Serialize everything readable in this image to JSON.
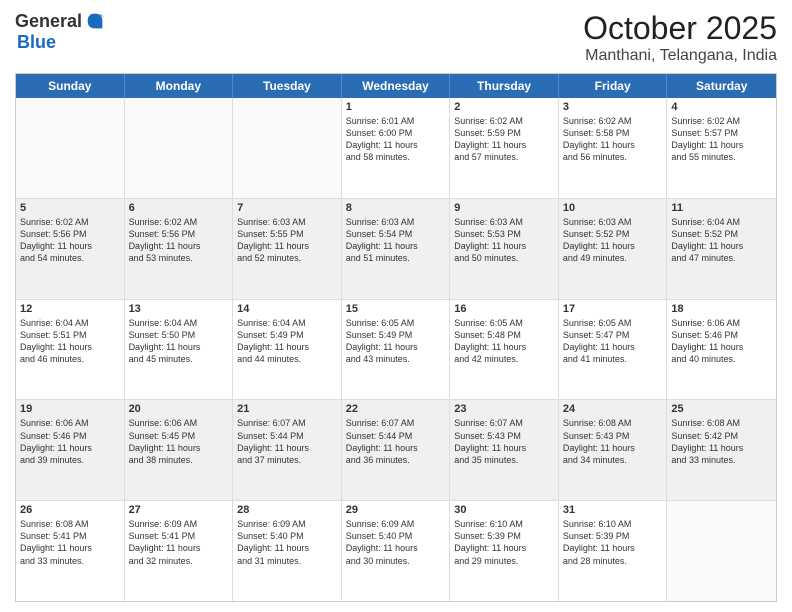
{
  "header": {
    "logo_general": "General",
    "logo_blue": "Blue",
    "title": "October 2025",
    "subtitle": "Manthani, Telangana, India"
  },
  "weekdays": [
    "Sunday",
    "Monday",
    "Tuesday",
    "Wednesday",
    "Thursday",
    "Friday",
    "Saturday"
  ],
  "weeks": [
    [
      {
        "day": "",
        "text": ""
      },
      {
        "day": "",
        "text": ""
      },
      {
        "day": "",
        "text": ""
      },
      {
        "day": "1",
        "text": "Sunrise: 6:01 AM\nSunset: 6:00 PM\nDaylight: 11 hours\nand 58 minutes."
      },
      {
        "day": "2",
        "text": "Sunrise: 6:02 AM\nSunset: 5:59 PM\nDaylight: 11 hours\nand 57 minutes."
      },
      {
        "day": "3",
        "text": "Sunrise: 6:02 AM\nSunset: 5:58 PM\nDaylight: 11 hours\nand 56 minutes."
      },
      {
        "day": "4",
        "text": "Sunrise: 6:02 AM\nSunset: 5:57 PM\nDaylight: 11 hours\nand 55 minutes."
      }
    ],
    [
      {
        "day": "5",
        "text": "Sunrise: 6:02 AM\nSunset: 5:56 PM\nDaylight: 11 hours\nand 54 minutes."
      },
      {
        "day": "6",
        "text": "Sunrise: 6:02 AM\nSunset: 5:56 PM\nDaylight: 11 hours\nand 53 minutes."
      },
      {
        "day": "7",
        "text": "Sunrise: 6:03 AM\nSunset: 5:55 PM\nDaylight: 11 hours\nand 52 minutes."
      },
      {
        "day": "8",
        "text": "Sunrise: 6:03 AM\nSunset: 5:54 PM\nDaylight: 11 hours\nand 51 minutes."
      },
      {
        "day": "9",
        "text": "Sunrise: 6:03 AM\nSunset: 5:53 PM\nDaylight: 11 hours\nand 50 minutes."
      },
      {
        "day": "10",
        "text": "Sunrise: 6:03 AM\nSunset: 5:52 PM\nDaylight: 11 hours\nand 49 minutes."
      },
      {
        "day": "11",
        "text": "Sunrise: 6:04 AM\nSunset: 5:52 PM\nDaylight: 11 hours\nand 47 minutes."
      }
    ],
    [
      {
        "day": "12",
        "text": "Sunrise: 6:04 AM\nSunset: 5:51 PM\nDaylight: 11 hours\nand 46 minutes."
      },
      {
        "day": "13",
        "text": "Sunrise: 6:04 AM\nSunset: 5:50 PM\nDaylight: 11 hours\nand 45 minutes."
      },
      {
        "day": "14",
        "text": "Sunrise: 6:04 AM\nSunset: 5:49 PM\nDaylight: 11 hours\nand 44 minutes."
      },
      {
        "day": "15",
        "text": "Sunrise: 6:05 AM\nSunset: 5:49 PM\nDaylight: 11 hours\nand 43 minutes."
      },
      {
        "day": "16",
        "text": "Sunrise: 6:05 AM\nSunset: 5:48 PM\nDaylight: 11 hours\nand 42 minutes."
      },
      {
        "day": "17",
        "text": "Sunrise: 6:05 AM\nSunset: 5:47 PM\nDaylight: 11 hours\nand 41 minutes."
      },
      {
        "day": "18",
        "text": "Sunrise: 6:06 AM\nSunset: 5:46 PM\nDaylight: 11 hours\nand 40 minutes."
      }
    ],
    [
      {
        "day": "19",
        "text": "Sunrise: 6:06 AM\nSunset: 5:46 PM\nDaylight: 11 hours\nand 39 minutes."
      },
      {
        "day": "20",
        "text": "Sunrise: 6:06 AM\nSunset: 5:45 PM\nDaylight: 11 hours\nand 38 minutes."
      },
      {
        "day": "21",
        "text": "Sunrise: 6:07 AM\nSunset: 5:44 PM\nDaylight: 11 hours\nand 37 minutes."
      },
      {
        "day": "22",
        "text": "Sunrise: 6:07 AM\nSunset: 5:44 PM\nDaylight: 11 hours\nand 36 minutes."
      },
      {
        "day": "23",
        "text": "Sunrise: 6:07 AM\nSunset: 5:43 PM\nDaylight: 11 hours\nand 35 minutes."
      },
      {
        "day": "24",
        "text": "Sunrise: 6:08 AM\nSunset: 5:43 PM\nDaylight: 11 hours\nand 34 minutes."
      },
      {
        "day": "25",
        "text": "Sunrise: 6:08 AM\nSunset: 5:42 PM\nDaylight: 11 hours\nand 33 minutes."
      }
    ],
    [
      {
        "day": "26",
        "text": "Sunrise: 6:08 AM\nSunset: 5:41 PM\nDaylight: 11 hours\nand 33 minutes."
      },
      {
        "day": "27",
        "text": "Sunrise: 6:09 AM\nSunset: 5:41 PM\nDaylight: 11 hours\nand 32 minutes."
      },
      {
        "day": "28",
        "text": "Sunrise: 6:09 AM\nSunset: 5:40 PM\nDaylight: 11 hours\nand 31 minutes."
      },
      {
        "day": "29",
        "text": "Sunrise: 6:09 AM\nSunset: 5:40 PM\nDaylight: 11 hours\nand 30 minutes."
      },
      {
        "day": "30",
        "text": "Sunrise: 6:10 AM\nSunset: 5:39 PM\nDaylight: 11 hours\nand 29 minutes."
      },
      {
        "day": "31",
        "text": "Sunrise: 6:10 AM\nSunset: 5:39 PM\nDaylight: 11 hours\nand 28 minutes."
      },
      {
        "day": "",
        "text": ""
      }
    ]
  ]
}
